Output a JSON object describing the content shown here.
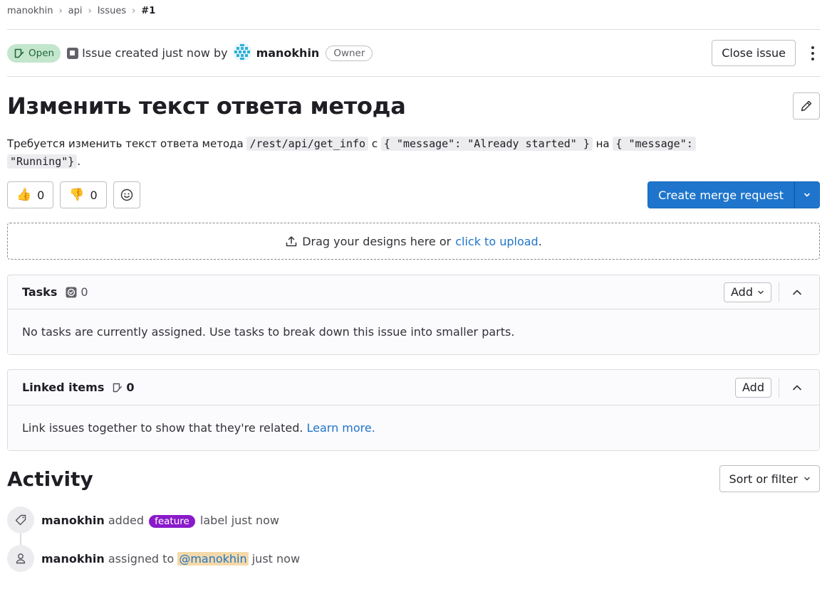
{
  "breadcrumb": {
    "items": [
      "manokhin",
      "api",
      "Issues"
    ],
    "current": "#1",
    "separator": "›"
  },
  "issue_header": {
    "status": "Open",
    "created_text": "Issue created just now by",
    "author": "manokhin",
    "role_badge": "Owner",
    "close_button": "Close issue"
  },
  "title": "Изменить текст ответа метода",
  "description": {
    "text_before": "Требуется изменить текст ответа метода",
    "code_1": "/rest/api/get_info",
    "text_mid_1": "с",
    "code_2": "{ \"message\": \"Already started\" }",
    "text_mid_2": "на",
    "code_3a": "{ \"message\":",
    "code_3b": "\"Running\"}",
    "text_end": "."
  },
  "reactions": {
    "thumbs_up": {
      "emoji": "👍",
      "count": "0"
    },
    "thumbs_down": {
      "emoji": "👎",
      "count": "0"
    }
  },
  "merge_request_button": "Create merge request",
  "upload": {
    "text": "Drag your designs here or",
    "link": "click to upload",
    "suffix": "."
  },
  "tasks": {
    "title": "Tasks",
    "count": "0",
    "add_label": "Add",
    "empty_text": "No tasks are currently assigned. Use tasks to break down this issue into smaller parts."
  },
  "linked_items": {
    "title": "Linked items",
    "count": "0",
    "add_label": "Add",
    "body_text": "Link issues together to show that they're related.",
    "learn_more": "Learn more."
  },
  "activity": {
    "title": "Activity",
    "sort_label": "Sort or filter",
    "events": [
      {
        "actor": "manokhin",
        "verb": "added",
        "label": "feature",
        "suffix": "label just now"
      },
      {
        "actor": "manokhin",
        "verb": "assigned to",
        "mention": "@manokhin",
        "suffix": "just now"
      }
    ]
  },
  "colors": {
    "primary": "#1f75cb",
    "open_badge_bg": "#c3e6cd",
    "open_badge_text": "#24663b",
    "feature_label": "#8a1ac9",
    "mention_bg": "#f5d9a8"
  },
  "icons": [
    "issue-open-icon",
    "issue-type-icon",
    "author-avatar",
    "pencil-icon",
    "smiley-icon",
    "chevron-down-icon",
    "upload-icon",
    "task-check-icon",
    "chevron-up-icon",
    "linked-issue-icon",
    "label-tag-icon",
    "user-icon",
    "kebab-icon"
  ]
}
